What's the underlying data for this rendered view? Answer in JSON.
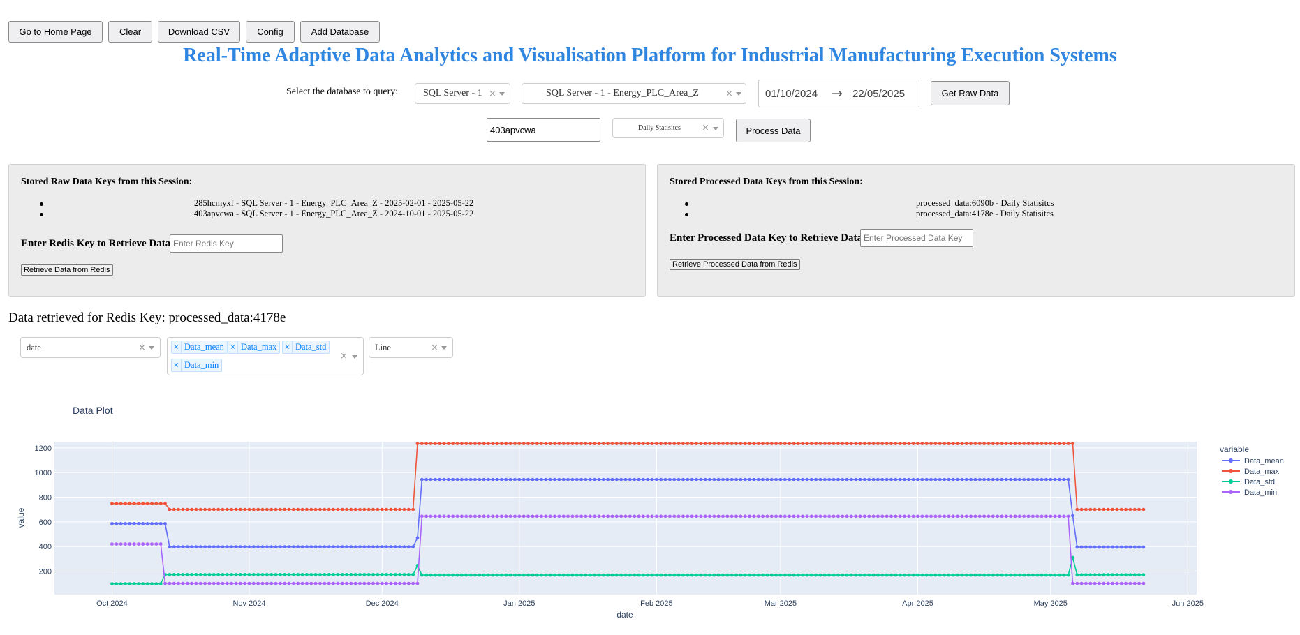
{
  "toolbar": {
    "home": "Go to Home Page",
    "clear": "Clear",
    "download": "Download CSV",
    "config": "Config",
    "add_db": "Add Database"
  },
  "title": "Real-Time Adaptive Data Analytics and Visualisation Platform for Industrial Manufacturing Execution Systems",
  "query": {
    "label": "Select the database to query:",
    "database": "SQL Server - 1",
    "table": "SQL Server - 1 - Energy_PLC_Area_Z",
    "start_date": "01/10/2024",
    "arrow": "→",
    "end_date": "22/05/2025",
    "get_raw": "Get Raw Data",
    "key_input": "403apvcwa",
    "process_type": "Daily Statisitcs",
    "process_btn": "Process Data"
  },
  "raw_panel": {
    "heading": "Stored Raw Data Keys from this Session:",
    "items": [
      "285hcmyxf - SQL Server - 1 - Energy_PLC_Area_Z - 2025-02-01 - 2025-05-22",
      "403apvcwa - SQL Server - 1 - Energy_PLC_Area_Z - 2024-10-01 - 2025-05-22"
    ],
    "input_label": "Enter Redis Key to Retrieve Data:",
    "input_placeholder": "Enter Redis Key",
    "button": "Retrieve Data from Redis"
  },
  "processed_panel": {
    "heading": "Stored Processed Data Keys from this Session:",
    "items": [
      "processed_data:6090b - Daily Statisitcs",
      "processed_data:4178e - Daily Statisitcs"
    ],
    "input_label": "Enter Processed Data Key to Retrieve Data:",
    "input_placeholder": "Enter Processed Data Key",
    "button": "Retrieve Processed Data from Redis"
  },
  "retrieved": "Data retrieved for Redis Key: processed_data:4178e",
  "controls": {
    "x_select": "date",
    "y_tags": [
      "Data_mean",
      "Data_max",
      "Data_std",
      "Data_min"
    ],
    "plot_type": "Line"
  },
  "colors": {
    "Data_mean": "#636efa",
    "Data_max": "#ef553b",
    "Data_std": "#00cc96",
    "Data_min": "#ab63fa",
    "title": "#2e86e0",
    "plot_bg": "#e5ecf6"
  },
  "chart_data": {
    "type": "line",
    "title": "Data Plot",
    "xlabel": "date",
    "ylabel": "value",
    "legend_title": "variable",
    "legend_position": "right",
    "x_range": [
      "2024-09-18",
      "2025-06-03"
    ],
    "ylim": [
      10,
      1250
    ],
    "x_ticks": [
      "Oct 2024",
      "Nov 2024",
      "Dec 2024",
      "Jan 2025",
      "Feb 2025",
      "Mar 2025",
      "Apr 2025",
      "May 2025",
      "Jun 2025"
    ],
    "y_ticks": [
      200,
      400,
      600,
      800,
      1000,
      1200
    ],
    "x_start": "2024-10-01",
    "x_end": "2025-05-22",
    "markers": true,
    "grid": true,
    "series": [
      {
        "name": "Data_mean",
        "segments": [
          {
            "from": "2024-10-01",
            "to": "2024-10-13",
            "value": 585
          },
          {
            "from": "2024-10-14",
            "to": "2024-12-08",
            "value": 397
          },
          {
            "from": "2024-12-09",
            "to": "2024-12-09",
            "value": 470
          },
          {
            "from": "2024-12-10",
            "to": "2025-05-05",
            "value": 943
          },
          {
            "from": "2025-05-06",
            "to": "2025-05-06",
            "value": 650
          },
          {
            "from": "2025-05-07",
            "to": "2025-05-22",
            "value": 395
          }
        ]
      },
      {
        "name": "Data_max",
        "segments": [
          {
            "from": "2024-10-01",
            "to": "2024-10-13",
            "value": 748
          },
          {
            "from": "2024-10-14",
            "to": "2024-12-08",
            "value": 700
          },
          {
            "from": "2024-12-09",
            "to": "2025-05-06",
            "value": 1235
          },
          {
            "from": "2025-05-07",
            "to": "2025-05-22",
            "value": 700
          }
        ]
      },
      {
        "name": "Data_std",
        "segments": [
          {
            "from": "2024-10-01",
            "to": "2024-10-12",
            "value": 97
          },
          {
            "from": "2024-10-13",
            "to": "2024-12-08",
            "value": 172
          },
          {
            "from": "2024-12-09",
            "to": "2024-12-09",
            "value": 245
          },
          {
            "from": "2024-12-10",
            "to": "2025-05-05",
            "value": 168
          },
          {
            "from": "2025-05-06",
            "to": "2025-05-06",
            "value": 310
          },
          {
            "from": "2025-05-07",
            "to": "2025-05-22",
            "value": 170
          }
        ]
      },
      {
        "name": "Data_min",
        "segments": [
          {
            "from": "2024-10-01",
            "to": "2024-10-12",
            "value": 420
          },
          {
            "from": "2024-10-13",
            "to": "2024-12-09",
            "value": 100
          },
          {
            "from": "2024-12-10",
            "to": "2025-05-05",
            "value": 645
          },
          {
            "from": "2025-05-06",
            "to": "2025-05-22",
            "value": 100
          }
        ]
      }
    ]
  }
}
